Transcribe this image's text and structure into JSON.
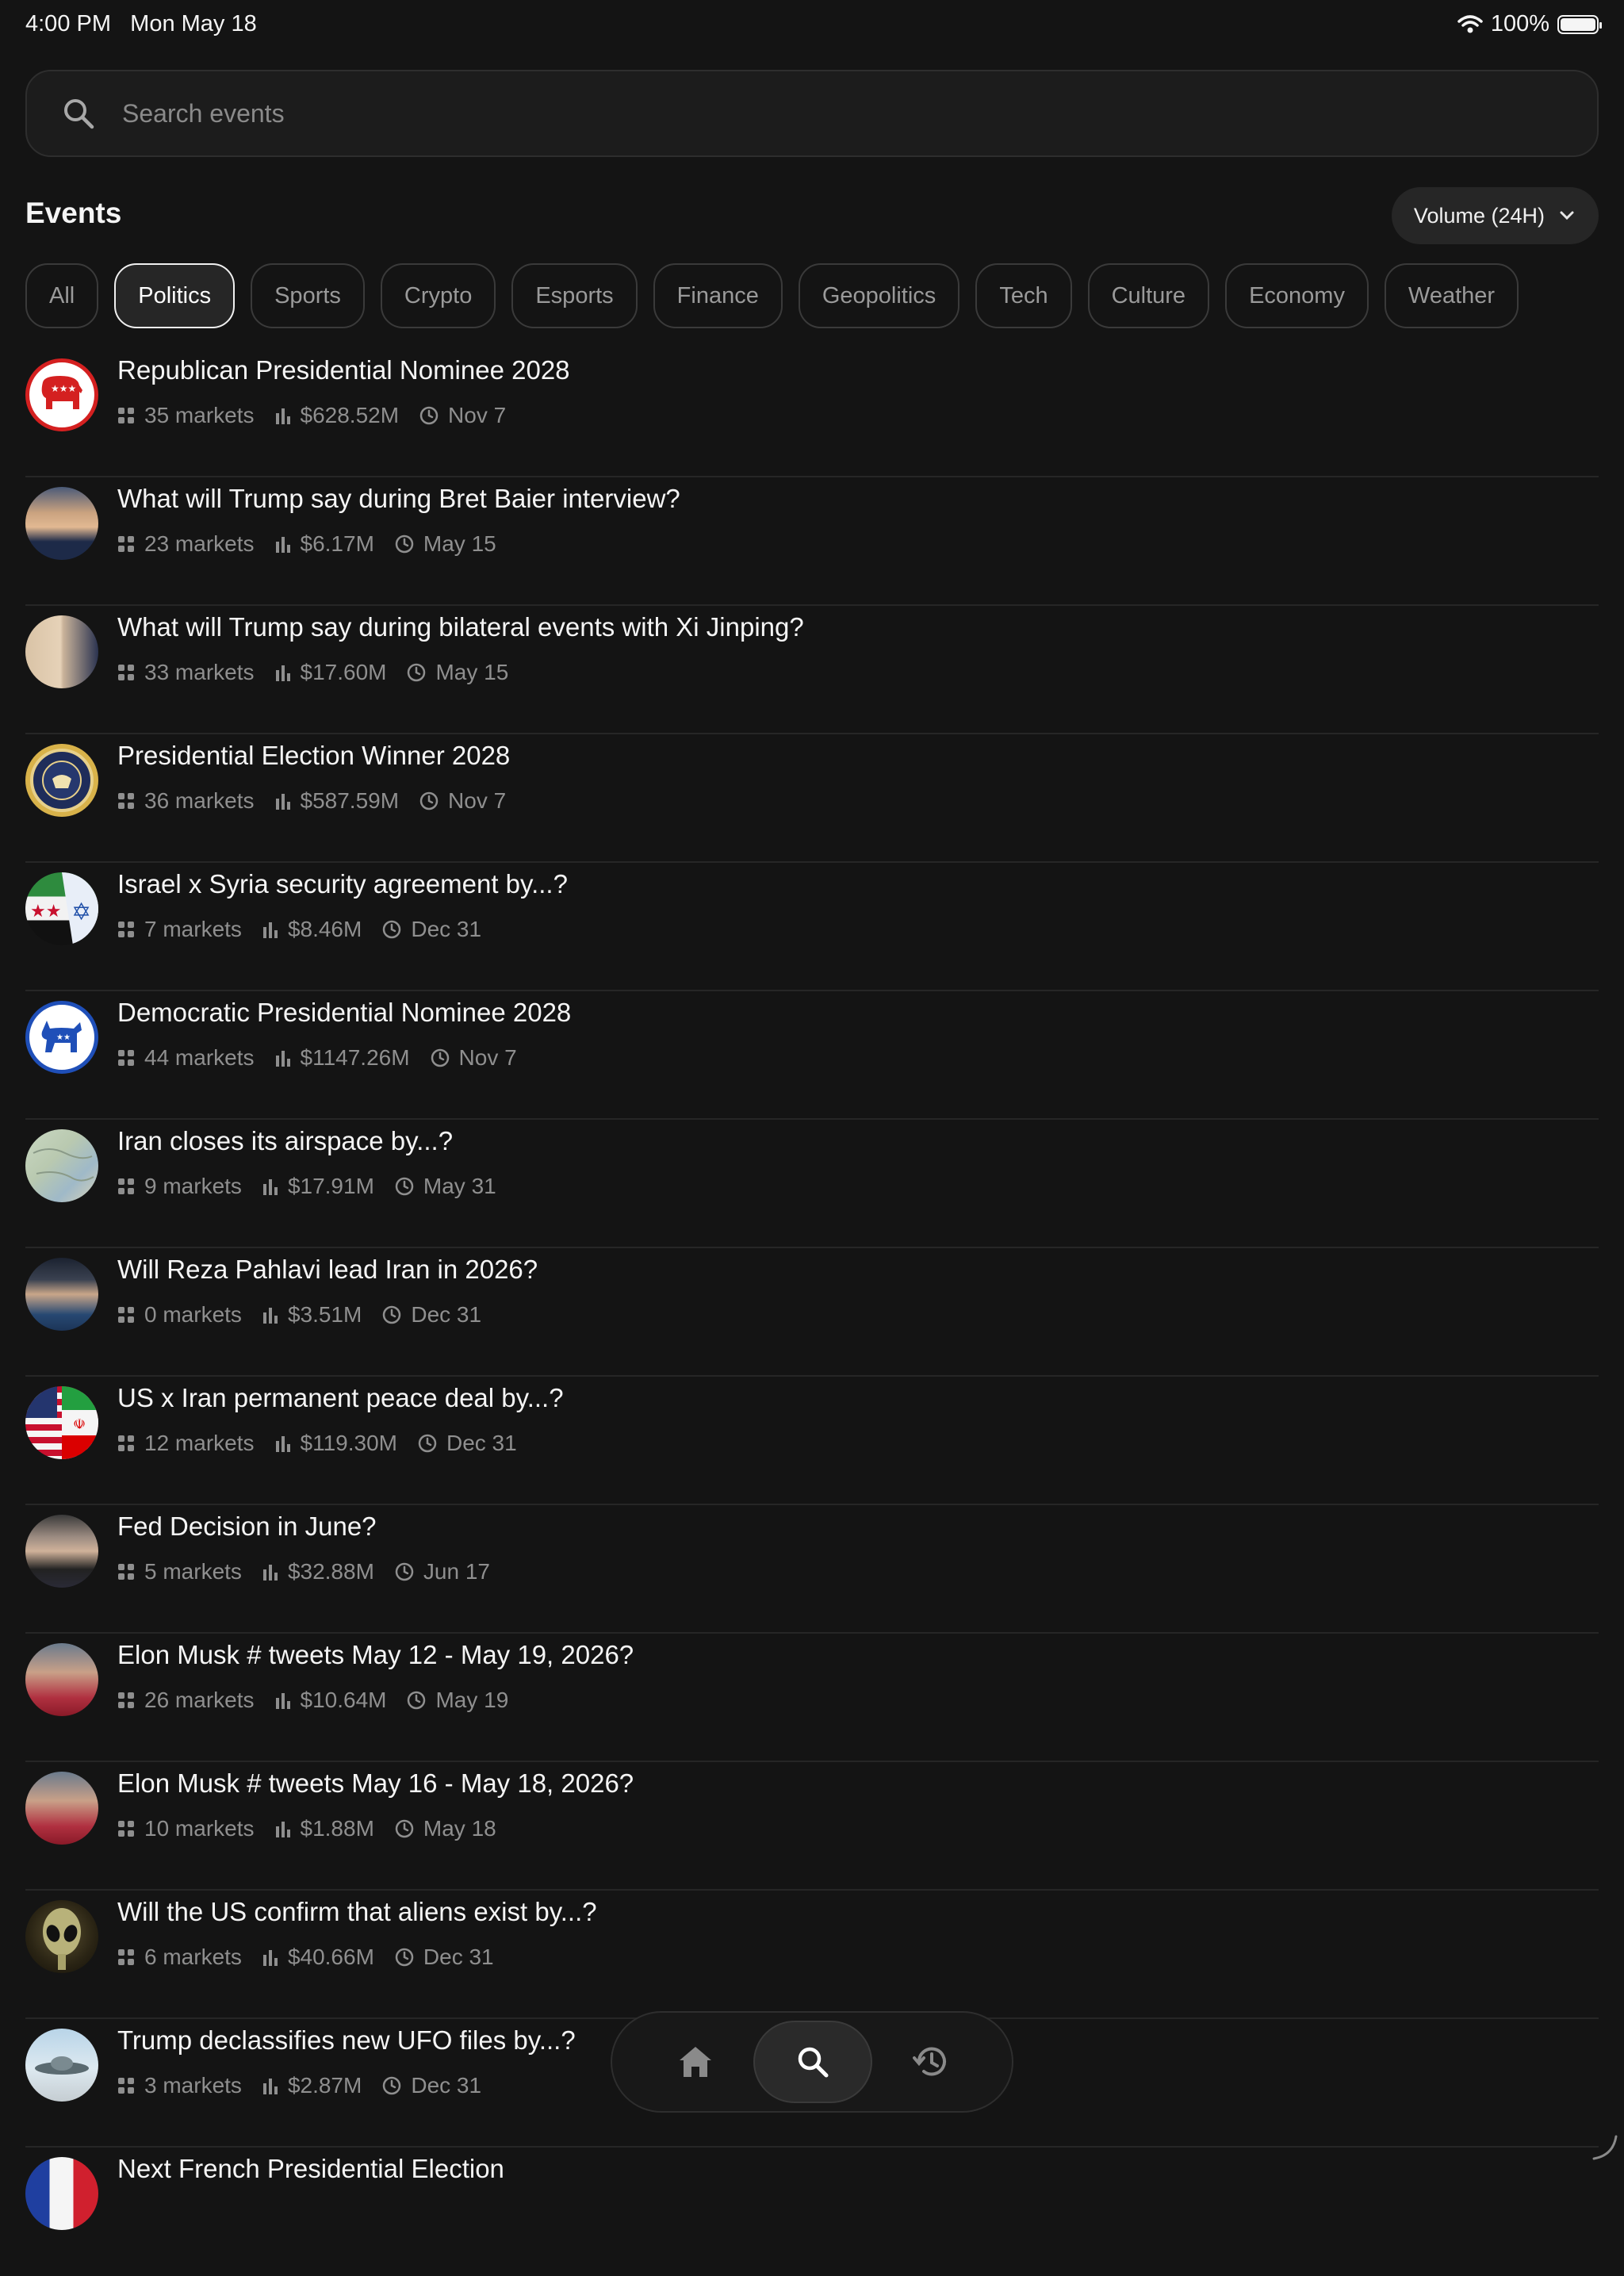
{
  "status": {
    "time": "4:00 PM",
    "date": "Mon May 18",
    "battery": "100%"
  },
  "search": {
    "placeholder": "Search events"
  },
  "header": {
    "title": "Events",
    "sort_label": "Volume (24H)"
  },
  "categories": [
    "All",
    "Politics",
    "Sports",
    "Crypto",
    "Esports",
    "Finance",
    "Geopolitics",
    "Tech",
    "Culture",
    "Economy",
    "Weather"
  ],
  "active_category": "Politics",
  "events": [
    {
      "title": "Republican Presidential Nominee 2028",
      "markets": "35 markets",
      "volume": "$628.52M",
      "date": "Nov 7",
      "icon": "republican-elephant-icon"
    },
    {
      "title": "What will Trump say during Bret Baier interview?",
      "markets": "23 markets",
      "volume": "$6.17M",
      "date": "May 15",
      "icon": "trump-photo-icon"
    },
    {
      "title": "What will Trump say during bilateral events with Xi Jinping?",
      "markets": "33 markets",
      "volume": "$17.60M",
      "date": "May 15",
      "icon": "trump-xi-photo-icon"
    },
    {
      "title": "Presidential Election Winner 2028",
      "markets": "36 markets",
      "volume": "$587.59M",
      "date": "Nov 7",
      "icon": "presidential-seal-icon"
    },
    {
      "title": "Israel x Syria security agreement by...?",
      "markets": "7 markets",
      "volume": "$8.46M",
      "date": "Dec 31",
      "icon": "israel-syria-flags-icon"
    },
    {
      "title": "Democratic Presidential Nominee 2028",
      "markets": "44 markets",
      "volume": "$1147.26M",
      "date": "Nov 7",
      "icon": "democratic-donkey-icon"
    },
    {
      "title": "Iran closes its airspace by...?",
      "markets": "9 markets",
      "volume": "$17.91M",
      "date": "May 31",
      "icon": "iran-map-icon"
    },
    {
      "title": "Will Reza Pahlavi lead Iran in 2026?",
      "markets": "0 markets",
      "volume": "$3.51M",
      "date": "Dec 31",
      "icon": "pahlavi-photo-icon"
    },
    {
      "title": "US x Iran permanent peace deal by...?",
      "markets": "12 markets",
      "volume": "$119.30M",
      "date": "Dec 31",
      "icon": "us-iran-flags-icon"
    },
    {
      "title": "Fed Decision in June?",
      "markets": "5 markets",
      "volume": "$32.88M",
      "date": "Jun 17",
      "icon": "powell-photo-icon"
    },
    {
      "title": "Elon Musk # tweets May 12 - May 19, 2026?",
      "markets": "26 markets",
      "volume": "$10.64M",
      "date": "May 19",
      "icon": "musk-photo-icon"
    },
    {
      "title": "Elon Musk # tweets May 16 - May 18, 2026?",
      "markets": "10 markets",
      "volume": "$1.88M",
      "date": "May 18",
      "icon": "musk-photo-icon"
    },
    {
      "title": "Will the US confirm that aliens exist by...?",
      "markets": "6 markets",
      "volume": "$40.66M",
      "date": "Dec 31",
      "icon": "alien-icon"
    },
    {
      "title": "Trump declassifies new UFO files by...?",
      "markets": "3 markets",
      "volume": "$2.87M",
      "date": "Dec 31",
      "icon": "ufo-icon"
    },
    {
      "title": "Next French Presidential Election",
      "markets": "",
      "volume": "",
      "date": "",
      "icon": "france-flag-icon"
    }
  ],
  "tabs": [
    {
      "name": "home-icon",
      "active": false
    },
    {
      "name": "search-icon",
      "active": true
    },
    {
      "name": "history-icon",
      "active": false
    }
  ],
  "colors": {
    "background": "#141414",
    "surface": "#1c1c1c",
    "divider": "#262626",
    "text": "#f5f5f5",
    "muted": "#8f8f8f"
  }
}
